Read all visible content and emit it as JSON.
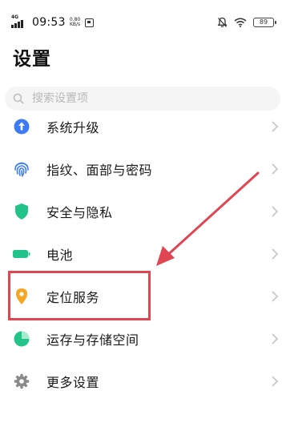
{
  "status_bar": {
    "network_type": "4G",
    "time": "09:53",
    "net_speed_value": "0.80",
    "net_speed_unit": "KB/s",
    "battery": "89"
  },
  "page": {
    "title": "设置"
  },
  "search": {
    "placeholder": "搜索设置项"
  },
  "menu": {
    "items": [
      {
        "label": "系统升级",
        "icon": "system-update-icon",
        "color": "#3d7bf5"
      },
      {
        "label": "指纹、面部与密码",
        "icon": "fingerprint-icon",
        "color": "#3d7bf5"
      },
      {
        "label": "安全与隐私",
        "icon": "shield-icon",
        "color": "#22c48a"
      },
      {
        "label": "电池",
        "icon": "battery-icon",
        "color": "#22c48a"
      },
      {
        "label": "定位服务",
        "icon": "location-pin-icon",
        "color": "#f5a623"
      },
      {
        "label": "运存与存储空间",
        "icon": "storage-pie-icon",
        "color": "#22c48a"
      },
      {
        "label": "更多设置",
        "icon": "gear-icon",
        "color": "#8a8a8a"
      }
    ]
  },
  "annotation": {
    "color": "#e04552"
  }
}
